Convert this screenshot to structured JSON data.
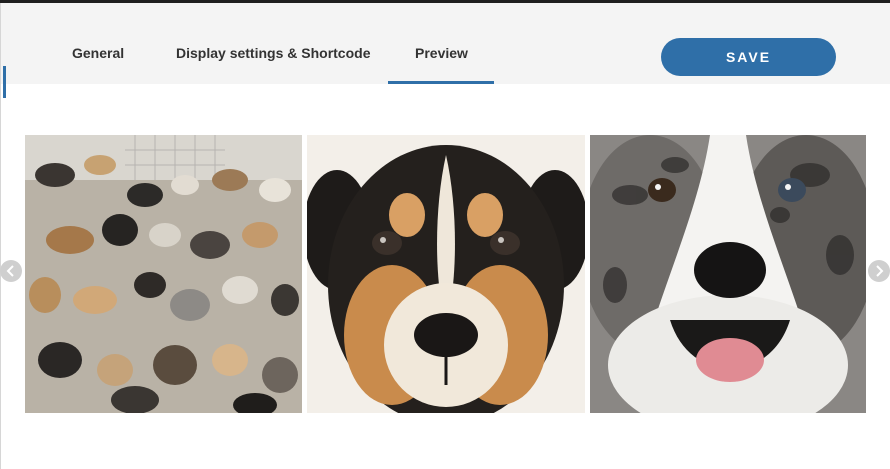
{
  "tabs": [
    {
      "label": "General"
    },
    {
      "label": "Display settings & Shortcode"
    },
    {
      "label": "Preview",
      "active": true
    }
  ],
  "save_button": {
    "label": "SAVE"
  },
  "colors": {
    "accent": "#2f6fa8",
    "header_bg": "#f4f4f4"
  },
  "gallery": {
    "images": [
      {
        "name": "dog-pack-photo"
      },
      {
        "name": "puppy-closeup-photo"
      },
      {
        "name": "merle-dog-photo"
      }
    ],
    "prev_icon": "chevron-left-icon",
    "next_icon": "chevron-right-icon"
  }
}
